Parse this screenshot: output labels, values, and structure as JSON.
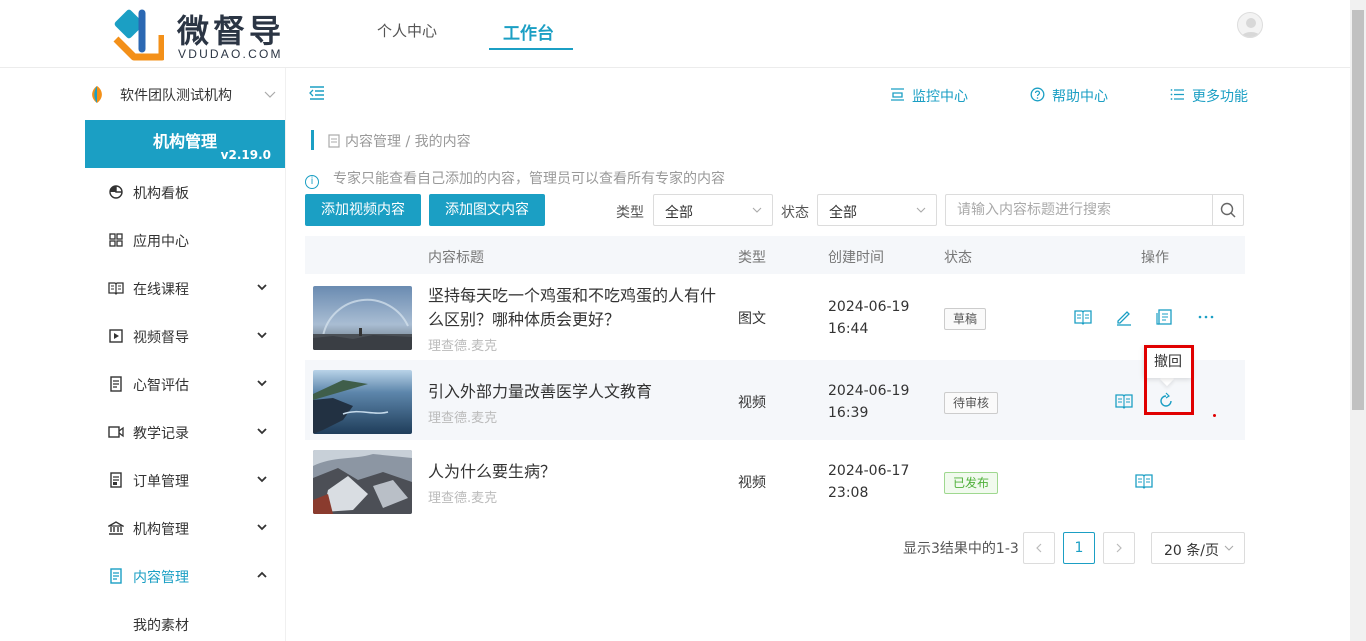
{
  "brand": {
    "name": "微督导",
    "sub": "VDUDAO.COM",
    "accent": "#1b9fc4"
  },
  "nav": {
    "tabs": [
      {
        "label": "个人中心"
      },
      {
        "label": "工作台",
        "active": true
      }
    ]
  },
  "org": {
    "name": "软件团队测试机构"
  },
  "sidebar": {
    "banner_title": "机构管理",
    "version": "v2.19.0",
    "items": [
      {
        "label": "机构看板",
        "icon": "pie-chart-icon"
      },
      {
        "label": "应用中心",
        "icon": "grid-icon"
      },
      {
        "label": "在线课程",
        "icon": "book-icon",
        "expandable": true
      },
      {
        "label": "视频督导",
        "icon": "play-square-icon",
        "expandable": true
      },
      {
        "label": "心智评估",
        "icon": "clipboard-icon",
        "expandable": true
      },
      {
        "label": "教学记录",
        "icon": "video-camera-icon",
        "expandable": true
      },
      {
        "label": "订单管理",
        "icon": "order-icon",
        "expandable": true
      },
      {
        "label": "机构管理",
        "icon": "bank-icon",
        "expandable": true
      },
      {
        "label": "内容管理",
        "icon": "content-icon",
        "expandable": true,
        "expanded": true,
        "active": true
      }
    ],
    "sub_items": [
      {
        "label": "我的素材"
      }
    ]
  },
  "toolbar": {
    "links": [
      {
        "label": "监控中心",
        "icon": "monitor-icon"
      },
      {
        "label": "帮助中心",
        "icon": "help-icon"
      },
      {
        "label": "更多功能",
        "icon": "list-icon"
      }
    ]
  },
  "breadcrumb": "内容管理 / 我的内容",
  "notice": "专家只能查看自己添加的内容，管理员可以查看所有专家的内容",
  "actions": {
    "add_video": "添加视频内容",
    "add_article": "添加图文内容"
  },
  "filters": {
    "type_label": "类型",
    "type_value": "全部",
    "status_label": "状态",
    "status_value": "全部",
    "search_placeholder": "请输入内容标题进行搜索"
  },
  "table": {
    "headers": [
      "内容标题",
      "类型",
      "创建时间",
      "状态",
      "操作"
    ],
    "rows": [
      {
        "title": "坚持每天吃一个鸡蛋和不吃鸡蛋的人有什么区别？哪种体质会更好？",
        "author": "理查德.麦克",
        "type": "图文",
        "date": "2024-06-19",
        "time": "16:44",
        "status": "草稿",
        "ops": [
          "preview-icon",
          "edit-icon",
          "publish-icon",
          "more-icon"
        ]
      },
      {
        "title": "引入外部力量改善医学人文教育",
        "author": "理查德.麦克",
        "type": "视频",
        "date": "2024-06-19",
        "time": "16:39",
        "status": "待审核",
        "ops": [
          "preview-icon",
          "revoke-icon"
        ]
      },
      {
        "title": "人为什么要生病？",
        "author": "理查德.麦克",
        "type": "视频",
        "date": "2024-06-17",
        "time": "23:08",
        "status": "已发布",
        "ops": [
          "preview-icon"
        ]
      }
    ]
  },
  "tooltip": {
    "label": "撤回"
  },
  "pagination": {
    "info": "显示3结果中的1-3",
    "current": "1",
    "page_size": "20 条/页"
  }
}
